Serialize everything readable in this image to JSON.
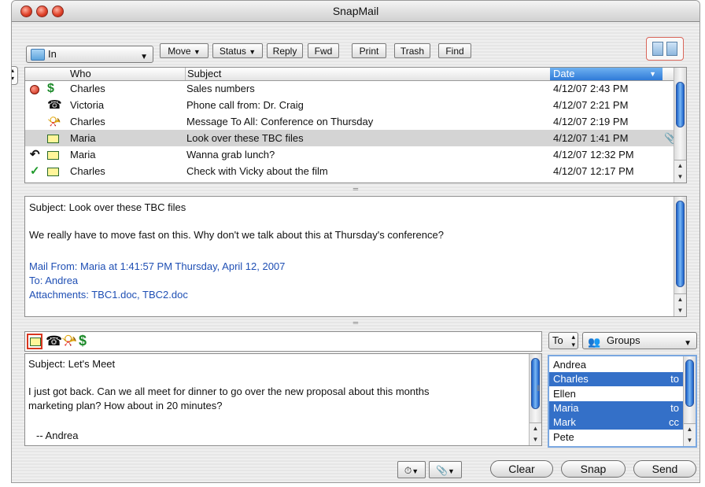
{
  "window": {
    "title": "SnapMail"
  },
  "toolbar": {
    "mailbox": "In",
    "move": "Move",
    "status": "Status",
    "reply": "Reply",
    "fwd": "Fwd",
    "print": "Print",
    "trash": "Trash",
    "find": "Find"
  },
  "list": {
    "headers": {
      "who": "Who",
      "subject": "Subject",
      "date": "Date"
    },
    "rows": [
      {
        "who": "Charles",
        "subject": "Sales numbers",
        "date": "4/12/07 2:43 PM",
        "status_icon": "red-dot-icon",
        "type_icon": "dollar-icon"
      },
      {
        "who": "Victoria",
        "subject": "Phone call from: Dr. Craig",
        "date": "4/12/07 2:21 PM",
        "status_icon": "",
        "type_icon": "phone-icon"
      },
      {
        "who": "Charles",
        "subject": "Message To All: Conference on Thursday",
        "date": "4/12/07 2:19 PM",
        "status_icon": "",
        "type_icon": "megaphone-icon"
      },
      {
        "who": "Maria",
        "subject": "Look over these TBC files",
        "date": "4/12/07 1:41 PM",
        "status_icon": "",
        "type_icon": "note-icon",
        "selected": true,
        "attachment": true
      },
      {
        "who": "Maria",
        "subject": "Wanna grab lunch?",
        "date": "4/12/07 12:32 PM",
        "status_icon": "reply-arrow-icon",
        "type_icon": "note-icon"
      },
      {
        "who": "Charles",
        "subject": "Check with Vicky about the film",
        "date": "4/12/07 12:17 PM",
        "status_icon": "checkmark-icon",
        "type_icon": "note-icon"
      }
    ]
  },
  "preview": {
    "subject": "Subject: Look over these TBC files",
    "body": "We really have to move fast on this.  Why don't we talk about this at Thursday's conference?",
    "mail_from": "Mail From: Maria at 1:41:57 PM Thursday, April 12, 2007",
    "to": "To: Andrea",
    "attachments": "Attachments:  TBC1.doc, TBC2.doc"
  },
  "compose": {
    "subject": "Subject: Let's Meet",
    "body_line1": "I just got back. Can we all meet for dinner to go over the new proposal about this months",
    "body_line2": "marketing plan? How about in 20 minutes?",
    "signature": "-- Andrea",
    "to_label": "To",
    "groups_label": "Groups",
    "recipients": [
      {
        "name": "Andrea",
        "type": "",
        "selected": false
      },
      {
        "name": "Charles",
        "type": "to",
        "selected": true
      },
      {
        "name": "Ellen",
        "type": "",
        "selected": false
      },
      {
        "name": "Maria",
        "type": "to",
        "selected": true
      },
      {
        "name": "Mark",
        "type": "cc",
        "selected": true
      },
      {
        "name": "Pete",
        "type": "",
        "selected": false
      }
    ]
  },
  "bottom": {
    "clear": "Clear",
    "snap": "Snap",
    "send": "Send"
  },
  "colors": {
    "selection": "#3470c8",
    "link_blue": "#1f4fb4",
    "row_highlight": "#d4d4d4",
    "accent_red": "#d8361f"
  }
}
